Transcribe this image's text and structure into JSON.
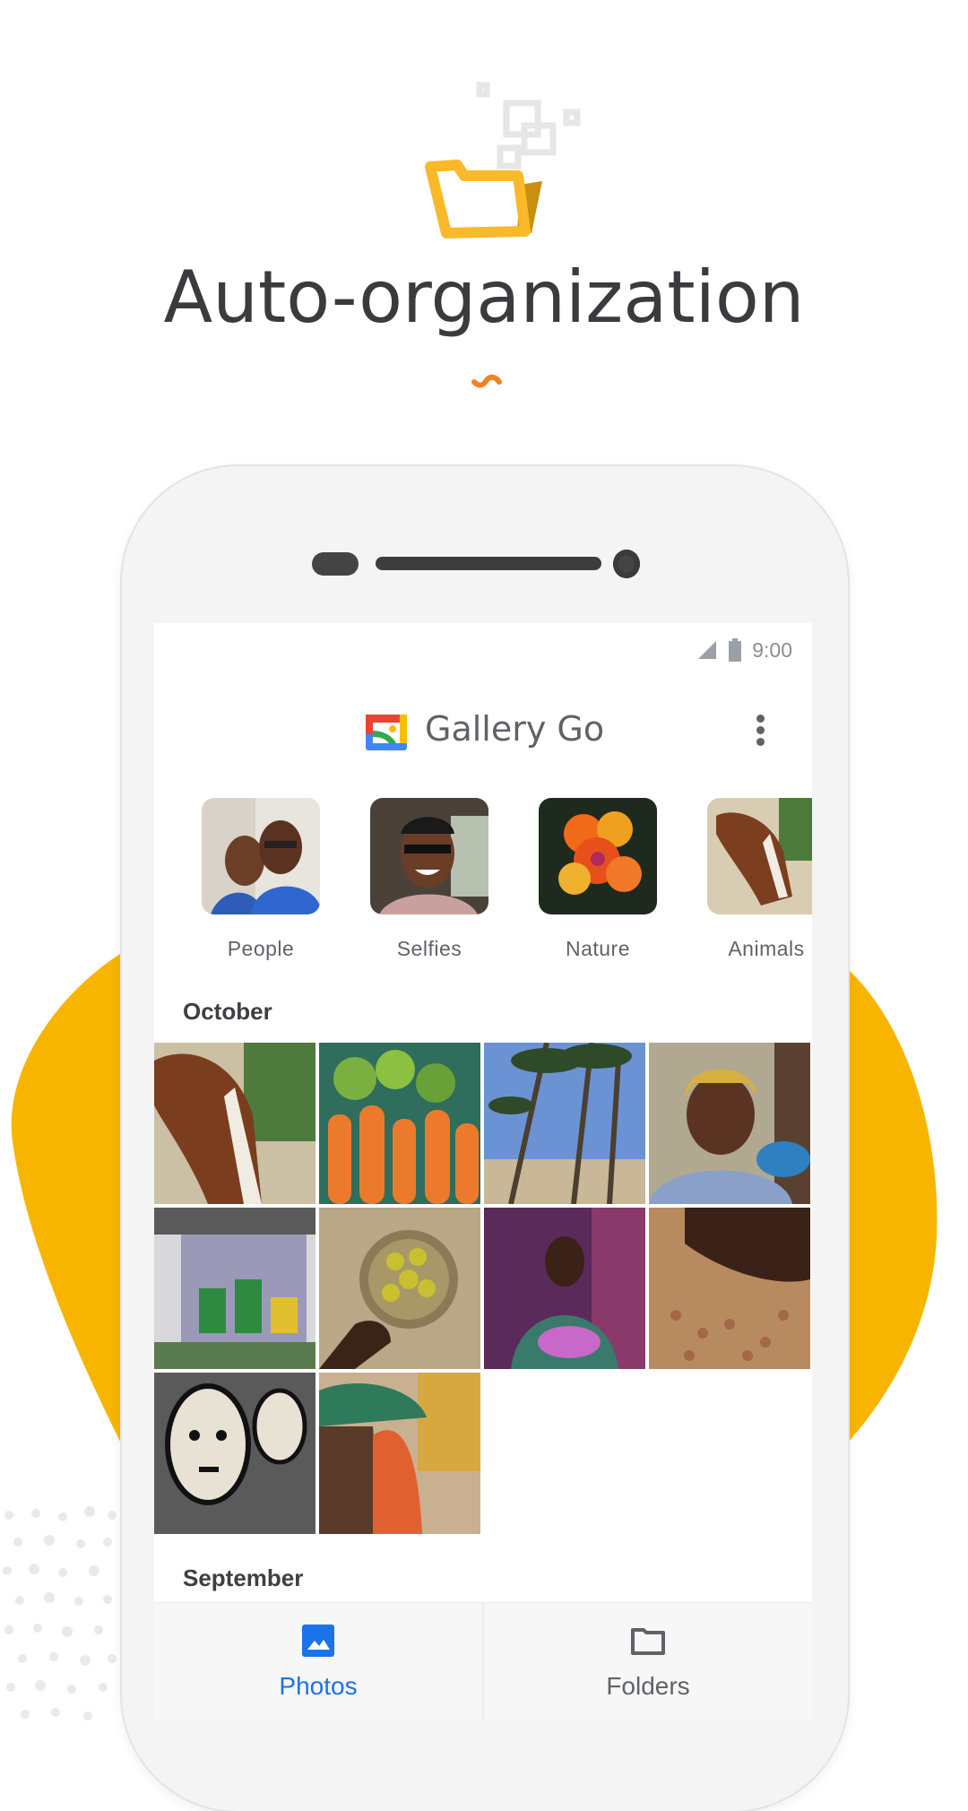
{
  "hero": {
    "headline": "Auto-organization",
    "icon": "folder-with-photos-icon",
    "colors": {
      "folder": "#F9B928",
      "folder_shade": "#C98F0F",
      "squiggle": "#F58220",
      "blob": "#F7B500"
    }
  },
  "status_bar": {
    "time": "9:00",
    "signal_icon": "signal-icon",
    "battery_icon": "battery-icon"
  },
  "app_bar": {
    "title": "Gallery Go",
    "logo_icon": "gallery-go-logo-icon",
    "menu_icon": "more-vert-icon"
  },
  "categories": [
    {
      "label": "People"
    },
    {
      "label": "Selfies"
    },
    {
      "label": "Nature"
    },
    {
      "label": "Animals"
    }
  ],
  "sections": [
    {
      "title": "October",
      "photos": [
        {
          "subject": "horse"
        },
        {
          "subject": "carrots and limes"
        },
        {
          "subject": "palm trees on beach"
        },
        {
          "subject": "smiling woman in headscarf"
        },
        {
          "subject": "mural under bridge"
        },
        {
          "subject": "hand holding bowl of fruit"
        },
        {
          "subject": "woman holding baby"
        },
        {
          "subject": "hands sorting beans"
        },
        {
          "subject": "black and white face mural"
        },
        {
          "subject": "market street"
        }
      ]
    },
    {
      "title": "September",
      "photos": []
    }
  ],
  "bottom_nav": {
    "items": [
      {
        "label": "Photos",
        "icon": "photo-icon",
        "active": true
      },
      {
        "label": "Folders",
        "icon": "folder-icon",
        "active": false
      }
    ],
    "active_color": "#1A73E8",
    "inactive_color": "#5F6368"
  }
}
